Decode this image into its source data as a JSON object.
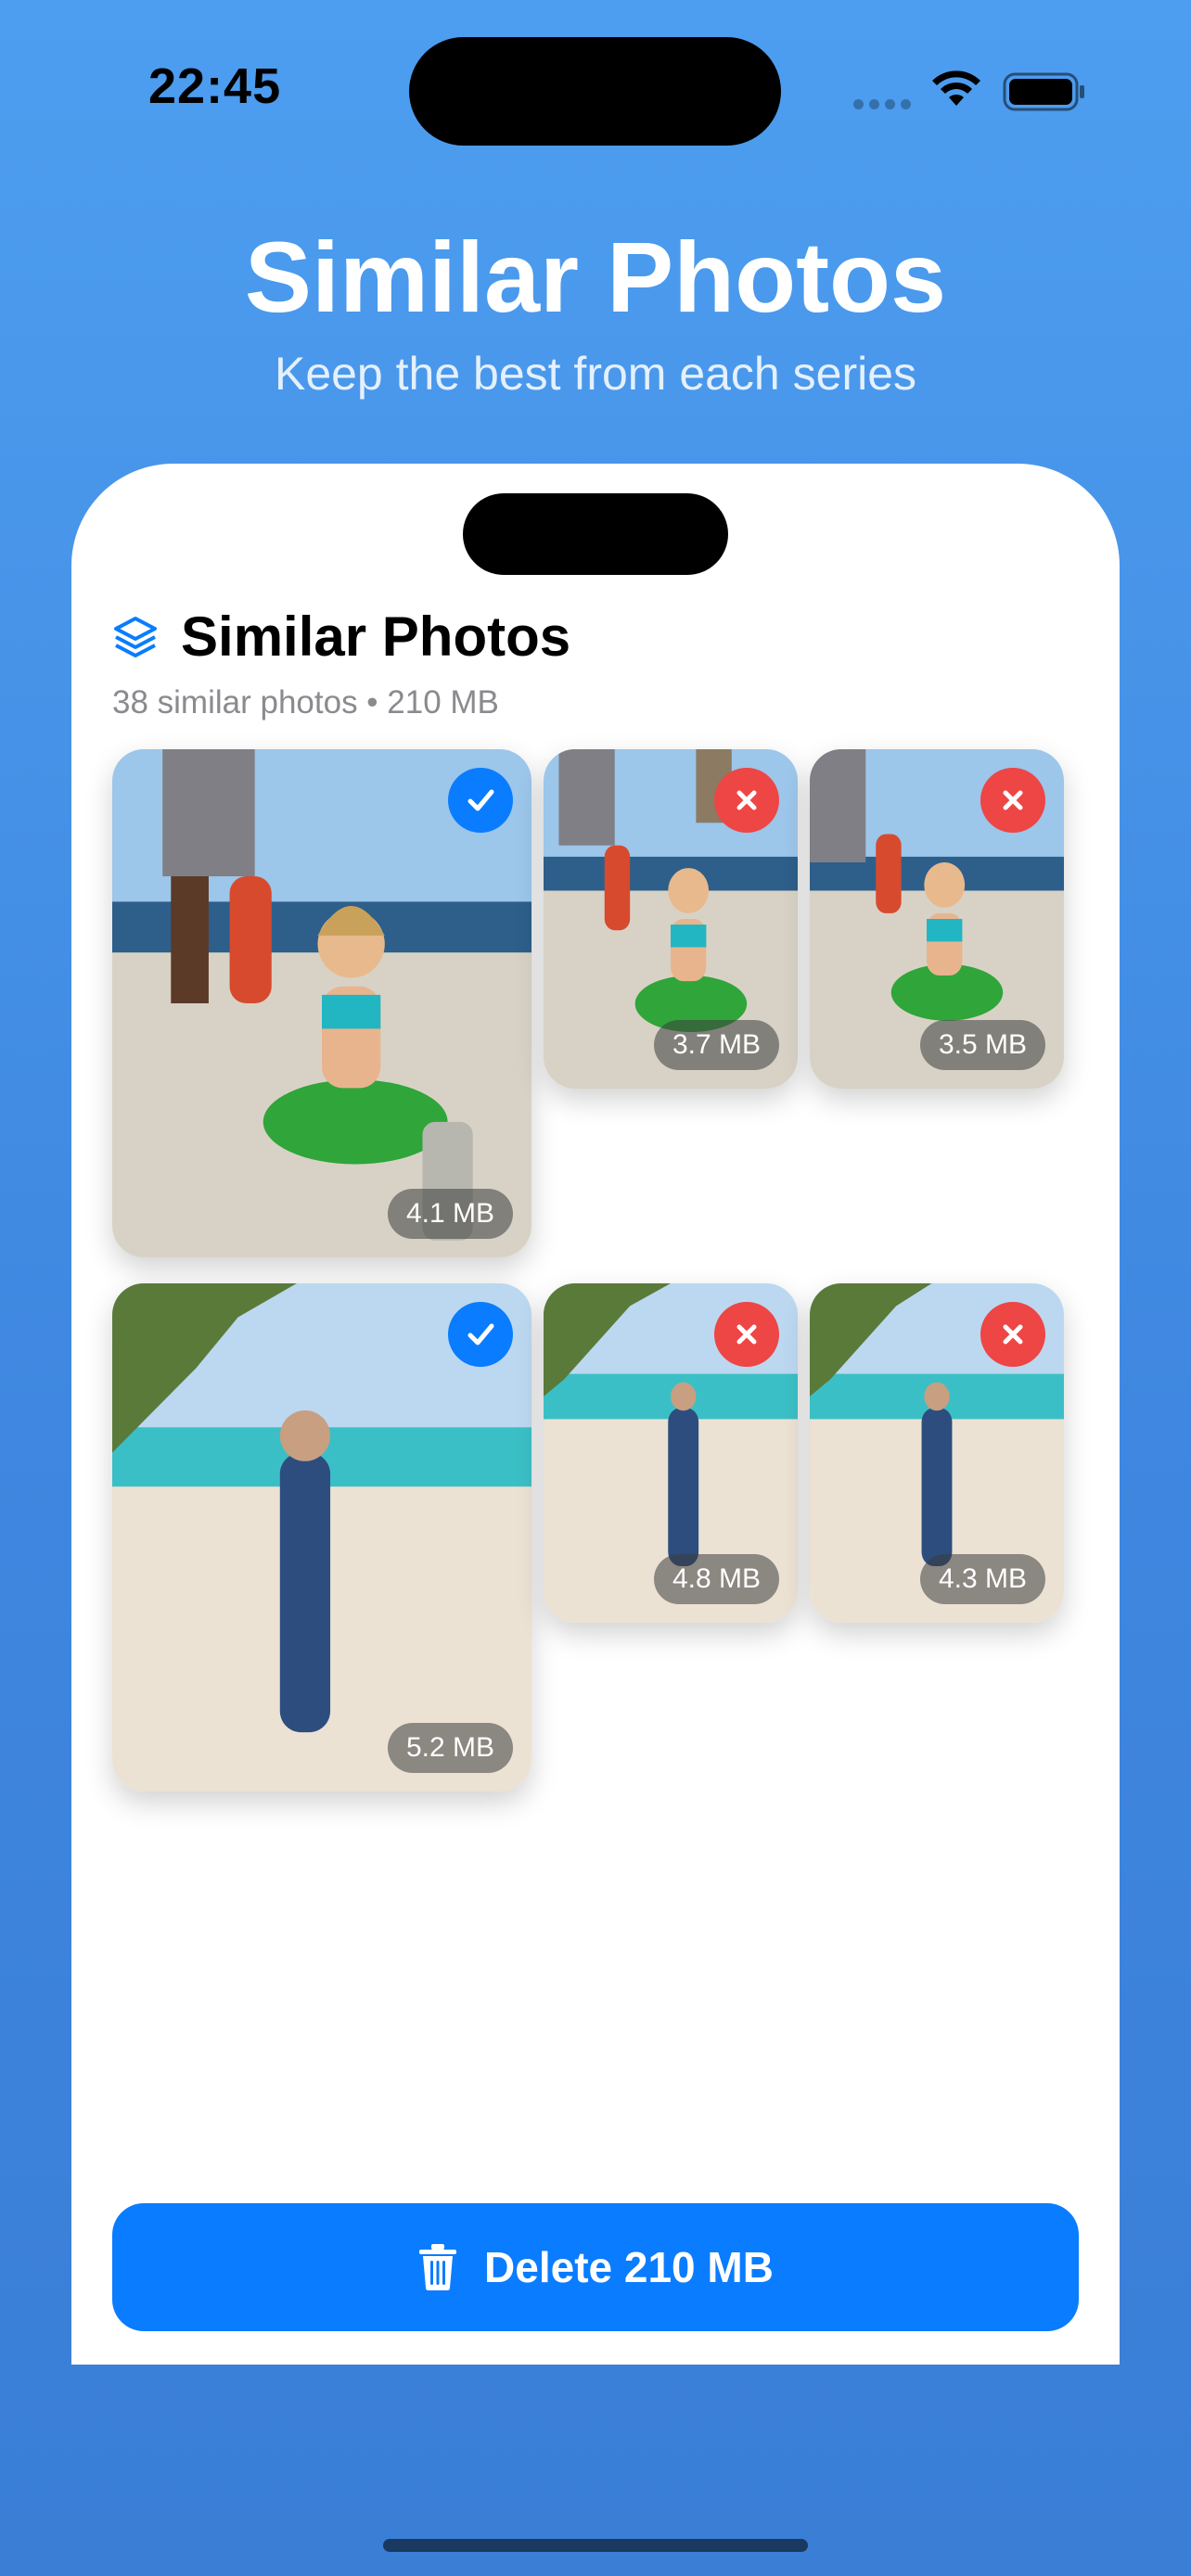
{
  "status_bar": {
    "time": "22:45"
  },
  "hero": {
    "title": "Similar Photos",
    "subtitle": "Keep the best from each series"
  },
  "section": {
    "title": "Similar Photos",
    "subtitle": "38 similar photos • 210 MB",
    "icon": "stack-icon"
  },
  "groups": [
    {
      "scene": "boat-fish",
      "photos": [
        {
          "size": "4.1 MB",
          "state": "keep"
        },
        {
          "size": "3.7 MB",
          "state": "delete"
        },
        {
          "size": "3.5 MB",
          "state": "delete"
        }
      ]
    },
    {
      "scene": "beach-palm",
      "photos": [
        {
          "size": "5.2 MB",
          "state": "keep"
        },
        {
          "size": "4.8 MB",
          "state": "delete"
        },
        {
          "size": "4.3 MB",
          "state": "delete"
        }
      ]
    }
  ],
  "delete_button": {
    "label": "Delete 210 MB",
    "icon": "trash-icon"
  },
  "colors": {
    "accent": "#0A7CFF",
    "delete_mark": "#EE4545",
    "background": "#4D9EF0"
  }
}
